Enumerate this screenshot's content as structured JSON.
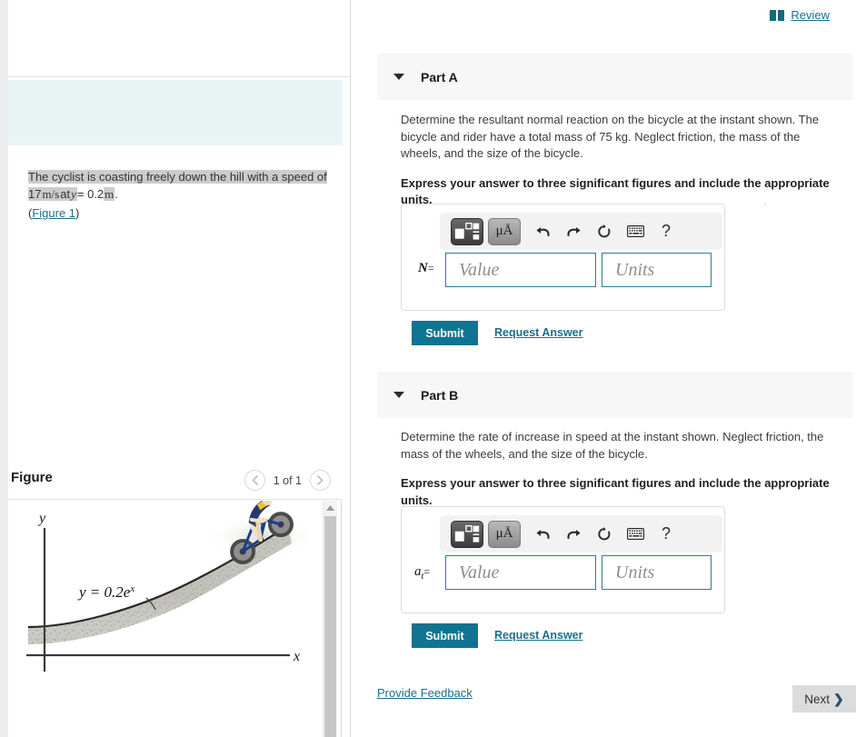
{
  "header": {
    "review_label": "Review",
    "review_icon": "book-icon"
  },
  "left": {
    "problem": {
      "line1_a": "The cyclist is coasting freely down the hill with a speed of",
      "line2_a": "17",
      "line2_b": "m/s",
      "line2_c": "at",
      "line2_d": "y",
      "line2_e": "= 0.2",
      "line2_f": "m",
      "line2_g": ".",
      "figure_link_open": "(",
      "figure_link": "Figure 1",
      "figure_link_close": ")"
    },
    "figure": {
      "title": "Figure",
      "count": "1 of 1",
      "prev_icon": "chevron-left-icon",
      "next_icon": "chevron-right-icon",
      "equation": "y = 0.2e",
      "equation_exp": "x",
      "axis_y": "y",
      "axis_x": "x"
    }
  },
  "parts": [
    {
      "id": "part-a",
      "label": "Part A",
      "caret_icon": "caret-down-icon",
      "question": "Determine the resultant normal reaction on the bicycle at the instant shown. The bicycle and rider have a total mass of 75 kg. Neglect friction, the mass of the wheels, and the size of the bicycle.",
      "instruction": "Express your answer to three significant figures and include the appropriate units.",
      "variable": "N",
      "variable_sub": "",
      "equals": "=",
      "value_placeholder": "Value",
      "units_placeholder": "Units",
      "submit_label": "Submit",
      "request_label": "Request Answer",
      "toolbar": {
        "template_button": "math-template-icon",
        "units_button": "μÅ",
        "undo_icon": "undo-icon",
        "redo_icon": "redo-icon",
        "reset_icon": "reset-icon",
        "keyboard_icon": "keyboard-icon",
        "help_icon": "?"
      }
    },
    {
      "id": "part-b",
      "label": "Part B",
      "caret_icon": "caret-down-icon",
      "question": "Determine the rate of increase in speed at the instant shown. Neglect friction, the mass of the wheels, and the size of the bicycle.",
      "instruction": "Express your answer to three significant figures and include the appropriate units.",
      "variable": "a",
      "variable_sub": "t",
      "equals": "=",
      "value_placeholder": "Value",
      "units_placeholder": "Units",
      "submit_label": "Submit",
      "request_label": "Request Answer",
      "toolbar": {
        "template_button": "math-template-icon",
        "units_button": "μÅ",
        "undo_icon": "undo-icon",
        "redo_icon": "redo-icon",
        "reset_icon": "reset-icon",
        "keyboard_icon": "keyboard-icon",
        "help_icon": "?"
      }
    }
  ],
  "footer": {
    "feedback_label": "Provide Feedback",
    "next_label": "Next",
    "next_icon": "chevron-right-icon"
  },
  "colors": {
    "accent": "#0e7490",
    "link": "#1a6f8a",
    "problem_bg": "#e8f4f4",
    "part_header_bg": "#f7f7f7",
    "field_border": "#2e7d8f"
  }
}
